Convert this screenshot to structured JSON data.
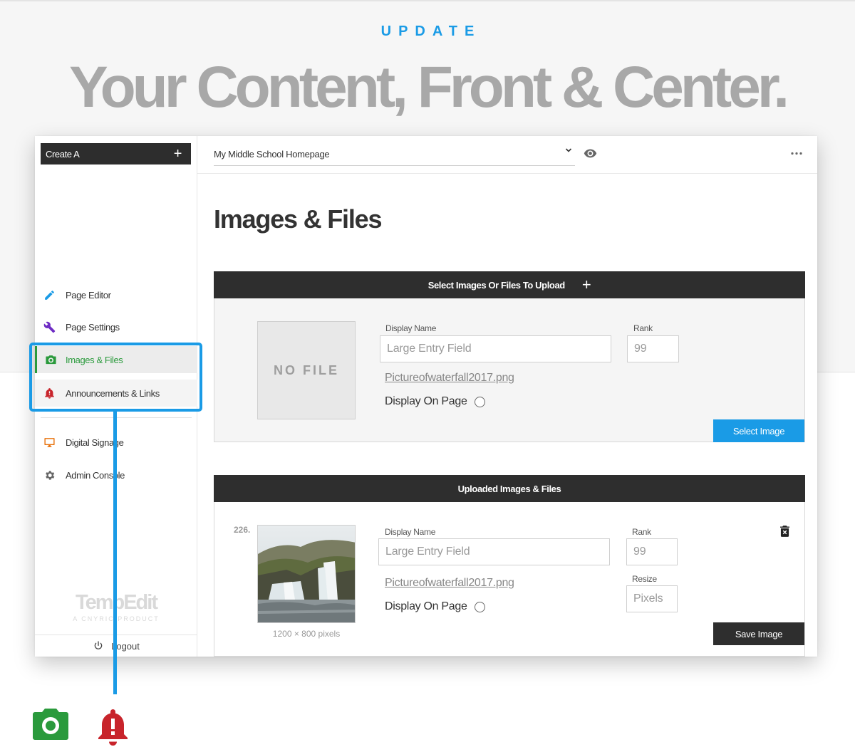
{
  "hero": {
    "eyebrow": "UPDATE",
    "headline": "Your Content, Front & Center."
  },
  "colors": {
    "accent_blue": "#1a9be6",
    "green": "#2a9a3c",
    "red": "#c8242b",
    "purple": "#6e2cc4",
    "orange": "#e8720c",
    "dark": "#2e2e2e"
  },
  "sidebar": {
    "create_label": "Create A",
    "create_icon": "plus-icon",
    "items": [
      {
        "label": "Page Editor",
        "icon": "pencil-icon"
      },
      {
        "label": "Page Settings",
        "icon": "wrench-icon"
      },
      {
        "label": "Images & Files",
        "icon": "camera-icon",
        "active": true
      },
      {
        "label": "Announcements & Links",
        "icon": "bell-alert-icon"
      },
      {
        "label": "Digital Signage",
        "icon": "monitor-icon"
      },
      {
        "label": "Admin Console",
        "icon": "gear-icon"
      }
    ],
    "brand_name": "TempEdit",
    "brand_sub": "A CNYRIC PRODUCT",
    "logout_label": "Logout"
  },
  "topbar": {
    "page_selected": "My Middle School Homepage"
  },
  "main": {
    "title": "Images & Files",
    "upload_panel": {
      "header": "Select Images Or Files To Upload",
      "no_file_text": "NO FILE",
      "display_name_label": "Display Name",
      "display_name_placeholder": "Large Entry Field",
      "rank_label": "Rank",
      "rank_placeholder": "99",
      "file_name": "Pictureofwaterfall2017.png",
      "display_on_page_label": "Display On Page",
      "select_button": "Select Image"
    },
    "uploaded_panel": {
      "header": "Uploaded Images & Files",
      "row_number": "226.",
      "image_caption": "1200 × 800 pixels",
      "display_name_label": "Display Name",
      "display_name_placeholder": "Large Entry Field",
      "rank_label": "Rank",
      "rank_placeholder": "99",
      "resize_label": "Resize",
      "resize_placeholder": "Pixels",
      "file_name": "Pictureofwaterfall2017.png",
      "display_on_page_label": "Display On Page",
      "save_button": "Save Image"
    }
  },
  "callout_icons": [
    "camera-icon",
    "bell-alert-icon"
  ]
}
